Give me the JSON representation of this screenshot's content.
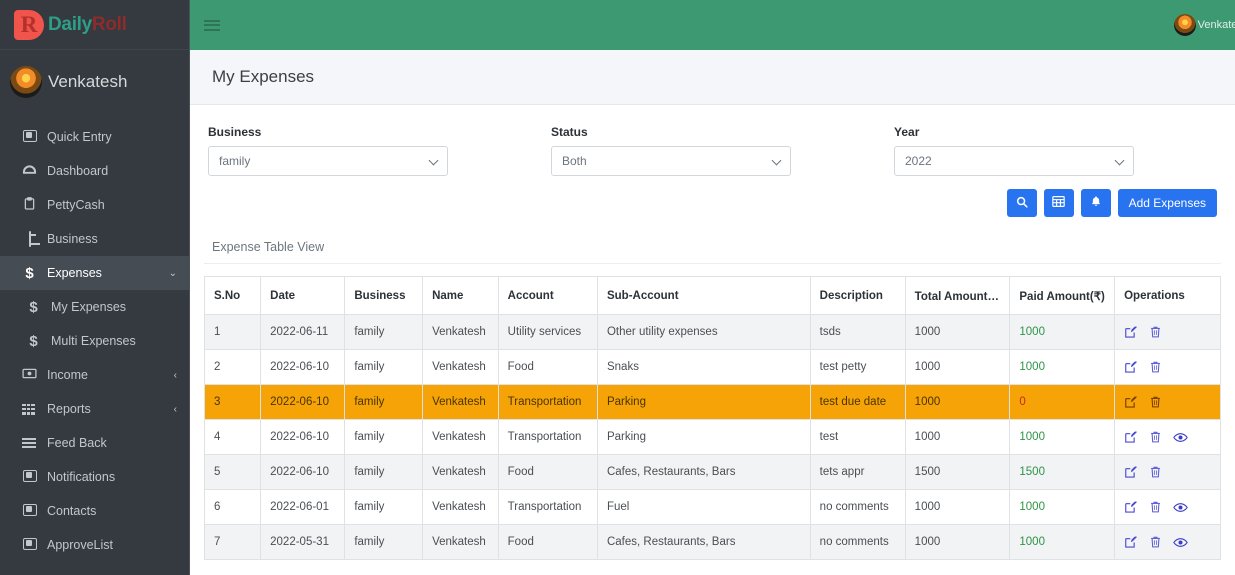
{
  "brand": {
    "mark": "R",
    "name_part1": "Daily",
    "name_part2": "Roll"
  },
  "sidebar": {
    "user": {
      "name": "Venkatesh",
      "avatar": "sunset-avatar"
    },
    "items": [
      {
        "label": "Quick Entry",
        "icon": "id-card-icon",
        "active": false,
        "sub": false,
        "caret": ""
      },
      {
        "label": "Dashboard",
        "icon": "dashboard-icon",
        "active": false,
        "sub": false,
        "caret": ""
      },
      {
        "label": "PettyCash",
        "icon": "clipboard-icon",
        "active": false,
        "sub": false,
        "caret": ""
      },
      {
        "label": "Business",
        "icon": "credit-card-icon",
        "active": false,
        "sub": false,
        "caret": ""
      },
      {
        "label": "Expenses",
        "icon": "dollar-icon",
        "active": true,
        "sub": false,
        "caret": "⌄"
      },
      {
        "label": "My Expenses",
        "icon": "dollar-icon",
        "active": false,
        "sub": true,
        "caret": ""
      },
      {
        "label": "Multi Expenses",
        "icon": "dollar-icon",
        "active": false,
        "sub": true,
        "caret": ""
      },
      {
        "label": "Income",
        "icon": "money-icon",
        "active": false,
        "sub": false,
        "caret": "‹"
      },
      {
        "label": "Reports",
        "icon": "grid-icon",
        "active": false,
        "sub": false,
        "caret": "‹"
      },
      {
        "label": "Feed Back",
        "icon": "bars-icon",
        "active": false,
        "sub": false,
        "caret": ""
      },
      {
        "label": "Notifications",
        "icon": "square-icon",
        "active": false,
        "sub": false,
        "caret": ""
      },
      {
        "label": "Contacts",
        "icon": "square-icon",
        "active": false,
        "sub": false,
        "caret": ""
      },
      {
        "label": "ApproveList",
        "icon": "square-icon",
        "active": false,
        "sub": false,
        "caret": ""
      }
    ]
  },
  "topbar": {
    "menu_icon": "hamburger-icon",
    "user_name": "Venkatesh",
    "bg_color": "#3d9972"
  },
  "page": {
    "title": "My Expenses"
  },
  "filters": [
    {
      "label": "Business",
      "value": "family",
      "name": "business-select"
    },
    {
      "label": "Status",
      "value": "Both",
      "name": "status-select"
    },
    {
      "label": "Year",
      "value": "2022",
      "name": "year-select"
    }
  ],
  "actions": {
    "search_icon": "search-icon",
    "table_icon": "table-icon",
    "bell_icon": "bell-icon",
    "add_label": "Add Expenses",
    "accent_color": "#2874f0"
  },
  "table": {
    "card_title": "Expense Table View",
    "columns": [
      "S.No",
      "Date",
      "Business",
      "Name",
      "Account",
      "Sub-Account",
      "Description",
      "Total Amount(₹)",
      "Paid Amount(₹)",
      "Operations"
    ],
    "rows": [
      {
        "sno": "1",
        "date": "2022-06-11",
        "business": "family",
        "name": "Venkatesh",
        "account": "Utility services",
        "sub_account": "Other utility expenses",
        "description": "tsds",
        "total": "1000",
        "paid": "1000",
        "ops": [
          "edit-icon",
          "delete-icon"
        ],
        "highlight": false
      },
      {
        "sno": "2",
        "date": "2022-06-10",
        "business": "family",
        "name": "Venkatesh",
        "account": "Food",
        "sub_account": "Snaks",
        "description": "test petty",
        "total": "1000",
        "paid": "1000",
        "ops": [
          "edit-icon",
          "delete-icon"
        ],
        "highlight": false
      },
      {
        "sno": "3",
        "date": "2022-06-10",
        "business": "family",
        "name": "Venkatesh",
        "account": "Transportation",
        "sub_account": "Parking",
        "description": "test due date",
        "total": "1000",
        "paid": "0",
        "ops": [
          "edit-icon",
          "delete-icon"
        ],
        "highlight": true
      },
      {
        "sno": "4",
        "date": "2022-06-10",
        "business": "family",
        "name": "Venkatesh",
        "account": "Transportation",
        "sub_account": "Parking",
        "description": "test",
        "total": "1000",
        "paid": "1000",
        "ops": [
          "edit-icon",
          "delete-icon",
          "view-icon"
        ],
        "highlight": false
      },
      {
        "sno": "5",
        "date": "2022-06-10",
        "business": "family",
        "name": "Venkatesh",
        "account": "Food",
        "sub_account": "Cafes, Restaurants, Bars",
        "description": "tets appr",
        "total": "1500",
        "paid": "1500",
        "ops": [
          "edit-icon",
          "delete-icon"
        ],
        "highlight": false
      },
      {
        "sno": "6",
        "date": "2022-06-01",
        "business": "family",
        "name": "Venkatesh",
        "account": "Transportation",
        "sub_account": "Fuel",
        "description": "no comments",
        "total": "1000",
        "paid": "1000",
        "ops": [
          "edit-icon",
          "delete-icon",
          "view-icon"
        ],
        "highlight": false
      },
      {
        "sno": "7",
        "date": "2022-05-31",
        "business": "family",
        "name": "Venkatesh",
        "account": "Food",
        "sub_account": "Cafes, Restaurants, Bars",
        "description": "no comments",
        "total": "1000",
        "paid": "1000",
        "ops": [
          "edit-icon",
          "delete-icon",
          "view-icon"
        ],
        "highlight": false
      }
    ]
  },
  "colors": {
    "sidebar_bg": "#343a40",
    "header_green": "#3d9972",
    "highlight_orange": "#f5a306",
    "paid_green": "#2e9448",
    "unpaid_red": "#c42b1c",
    "icon_indigo": "#4a4ad0"
  }
}
